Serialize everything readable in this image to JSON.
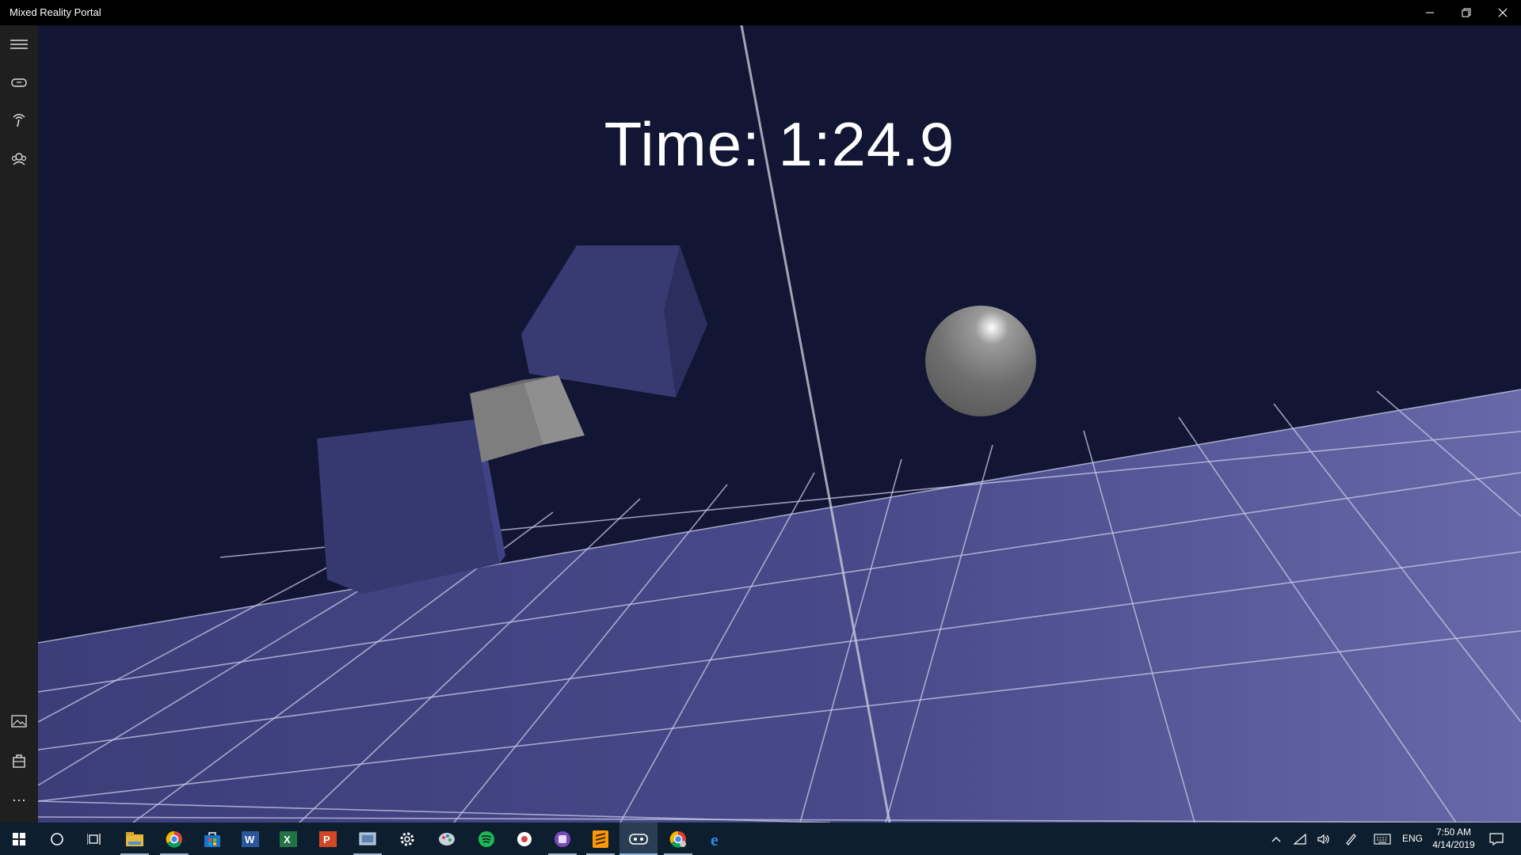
{
  "window": {
    "title": "Mixed Reality Portal",
    "controls": [
      "minimize-icon",
      "restore-icon",
      "close-icon"
    ]
  },
  "navrail": {
    "top_items": [
      "menu-icon",
      "headset-icon",
      "controller-icon",
      "people-icon"
    ],
    "bottom_items": [
      "photo-icon",
      "store-icon",
      "more-icon"
    ],
    "more_label": "⋯"
  },
  "scene": {
    "timer_text": "Time: 1:24.9",
    "sky_color": "#121533",
    "floor_color": "#47498a",
    "cube_color": "#383a72",
    "gray_color": "#7a7a7a"
  },
  "taskbar": {
    "start": "windows-start-icon",
    "search": "cortana-icon",
    "task_view": "task-view-icon",
    "apps": [
      "file-explorer-icon",
      "chrome-icon",
      "store-icon",
      "word-icon",
      "excel-icon",
      "powerpoint-icon",
      "control-panel-icon",
      "settings-icon",
      "paint-icon",
      "spotify-icon",
      "media-icon",
      "purple-app-icon",
      "sublime-icon",
      "mixed-reality-icon",
      "chrome-profile-icon",
      "edge-icon"
    ],
    "tray": {
      "language": "ENG",
      "time": "7:50 AM",
      "date": "4/14/2019"
    }
  }
}
